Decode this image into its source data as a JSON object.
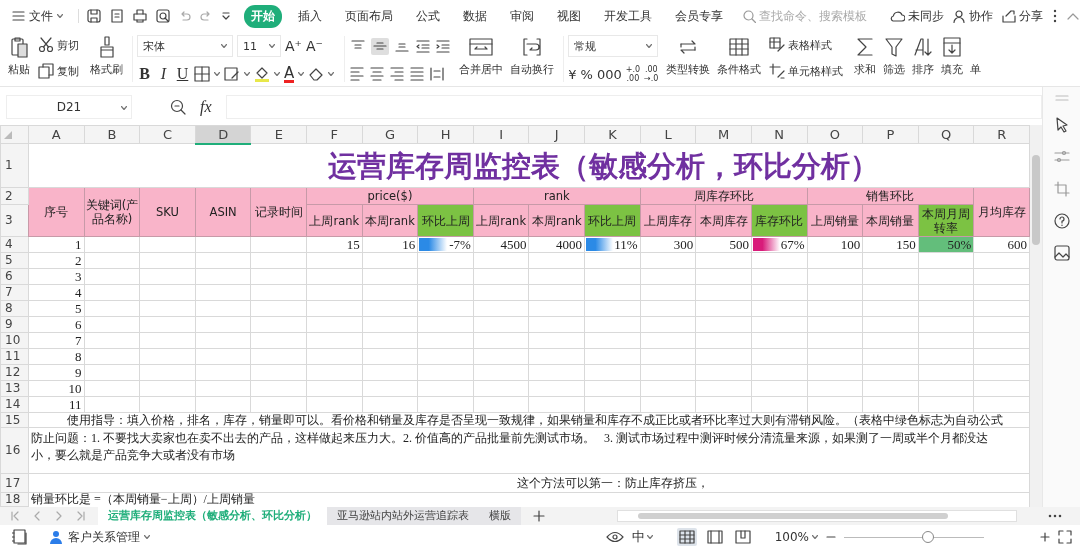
{
  "menu_bar": {
    "file_menu": "文件",
    "tabs": [
      {
        "label": "开始",
        "selected": true
      },
      {
        "label": "插入",
        "selected": false
      },
      {
        "label": "页面布局",
        "selected": false
      },
      {
        "label": "公式",
        "selected": false
      },
      {
        "label": "数据",
        "selected": false
      },
      {
        "label": "审阅",
        "selected": false
      },
      {
        "label": "视图",
        "selected": false
      },
      {
        "label": "开发工具",
        "selected": false
      },
      {
        "label": "会员专享",
        "selected": false
      }
    ],
    "search": {
      "placeholder": "查找命令、搜索模板"
    },
    "actions": [
      {
        "label": "未同步"
      },
      {
        "label": "协作"
      },
      {
        "label": "分享"
      }
    ]
  },
  "ribbon": {
    "clipboard": [
      {
        "label": "粘贴",
        "kind": "large"
      },
      {
        "label": "剪切",
        "kind": "small"
      },
      {
        "label": "复制",
        "kind": "small"
      },
      {
        "label": "格式刷",
        "kind": "large"
      }
    ],
    "font": {
      "name": "宋体",
      "size": "11",
      "grow": "A⁺",
      "shrink": "A⁻",
      "styles": [
        "B",
        "I",
        "U"
      ],
      "color_button": "A"
    },
    "align_toggles": [
      {
        "selected": false
      },
      {
        "selected": true
      },
      {
        "selected": false
      }
    ],
    "align_buttons": [
      {
        "label": "合并居中"
      },
      {
        "label": "自动换行"
      }
    ],
    "number_format": "常规",
    "number_symbols": [
      "¥",
      "%",
      "000"
    ],
    "decimal_buttons": [
      {
        "top": "+.0",
        "bottom": ".00"
      },
      {
        "top": ".00",
        "bottom": "→.0"
      }
    ],
    "tools": [
      {
        "label": "类型转换",
        "kind": "large"
      },
      {
        "label": "条件格式",
        "kind": "large"
      },
      {
        "label": "表格样式",
        "kind": "small"
      },
      {
        "label": "单元格样式",
        "kind": "small"
      },
      {
        "label": "求和",
        "kind": "large"
      },
      {
        "label": "筛选",
        "kind": "large"
      },
      {
        "label": "排序",
        "kind": "large"
      },
      {
        "label": "填充",
        "kind": "large"
      },
      {
        "label": "单",
        "kind": "large"
      }
    ]
  },
  "formula_bar": {
    "name_box": "D21",
    "function_label": "fx"
  },
  "sheet": {
    "columns": [
      {
        "letter": "A",
        "selected": false
      },
      {
        "letter": "B",
        "selected": false
      },
      {
        "letter": "C",
        "selected": false
      },
      {
        "letter": "D",
        "selected": true
      },
      {
        "letter": "E",
        "selected": false
      },
      {
        "letter": "F",
        "selected": false
      },
      {
        "letter": "G",
        "selected": false
      },
      {
        "letter": "H",
        "selected": false
      },
      {
        "letter": "I",
        "selected": false
      },
      {
        "letter": "J",
        "selected": false
      },
      {
        "letter": "K",
        "selected": false
      },
      {
        "letter": "L",
        "selected": false
      },
      {
        "letter": "M",
        "selected": false
      },
      {
        "letter": "N",
        "selected": false
      },
      {
        "letter": "O",
        "selected": false
      },
      {
        "letter": "P",
        "selected": false
      },
      {
        "letter": "Q",
        "selected": false
      },
      {
        "letter": "R",
        "selected": false
      }
    ],
    "row_numbers": [
      "1",
      "2",
      "3",
      "4",
      "5",
      "6",
      "7",
      "8",
      "9",
      "10",
      "11",
      "12",
      "13",
      "14",
      "15",
      "16",
      "17",
      "18"
    ],
    "title": "运营库存周监控表（敏感分析，环比分析）",
    "fixed_headers": [
      "序号",
      "关键词(产品名称)",
      "SKU",
      "ASIN",
      "记录时间"
    ],
    "groups": [
      "price($)",
      "rank",
      "周库存环比",
      "销售环比"
    ],
    "subheaders": [
      {
        "label": "上周rank",
        "color": "#f9b4c9"
      },
      {
        "label": "本周rank",
        "color": "#f9b4c9"
      },
      {
        "label": "环比上周",
        "color": "#7cc243"
      },
      {
        "label": "上周rank",
        "color": "#f9b4c9"
      },
      {
        "label": "本周rank",
        "color": "#f9b4c9"
      },
      {
        "label": "环比上周",
        "color": "#7cc243"
      },
      {
        "label": "上周库存",
        "color": "#f9b4c9"
      },
      {
        "label": "本周库存",
        "color": "#f9b4c9"
      },
      {
        "label": "库存环比",
        "color": "#7cc243"
      },
      {
        "label": "上周销量",
        "color": "#f9b4c9"
      },
      {
        "label": "本周销量",
        "color": "#f9b4c9"
      },
      {
        "label": "本周月周转率",
        "color": "#7cc243"
      }
    ],
    "last_header": "月均库存",
    "rows": [
      {
        "number": "1",
        "cells": [
          {
            "text": "15",
            "kind": "plain"
          },
          {
            "text": "16",
            "kind": "plain"
          },
          {
            "text": "-7%",
            "kind": "bar",
            "level": 0.5,
            "color": "#2b8ae6"
          },
          {
            "text": "4500",
            "kind": "plain"
          },
          {
            "text": "4000",
            "kind": "plain"
          },
          {
            "text": "11%",
            "kind": "bar",
            "level": 0.5,
            "color": "#2b8ae6"
          },
          {
            "text": "300",
            "kind": "plain"
          },
          {
            "text": "500",
            "kind": "plain"
          },
          {
            "text": "67%",
            "kind": "bar",
            "level": 0.5,
            "color": "#d81b7a"
          },
          {
            "text": "100",
            "kind": "plain"
          },
          {
            "text": "150",
            "kind": "plain"
          },
          {
            "text": "50%",
            "kind": "fill",
            "color": "#63be7b"
          },
          {
            "text": "600",
            "kind": "plain"
          }
        ]
      },
      {
        "number": "2"
      },
      {
        "number": "3"
      },
      {
        "number": "4"
      },
      {
        "number": "5"
      },
      {
        "number": "6"
      },
      {
        "number": "7"
      },
      {
        "number": "8"
      },
      {
        "number": "9"
      },
      {
        "number": "10"
      },
      {
        "number": "11"
      }
    ],
    "guide": "使用指导：填入价格，排名，库存，销量即可以。看价格和销量及库存是否呈现一致规律，如果销量和库存不成正比或者环比率过大则有滞销风险。（表格中绿色标志为自动公式",
    "prevention": [
      "防止问题：1. 不要找大卖家也在卖不出去的产品，这样做起来压力大。2. 价值高的产品批量前先测试市场。   3. 测试市场过程中测评时候分清流量来源，如果测了一周或半个月都没达",
      "小，要么就是产品竞争大或者没有市场"
    ],
    "method": "这个方法可以第一：防止库存挤压，",
    "formula": "销量环比是 =（本周销量−上周）/上周销量"
  },
  "sheet_tabs": [
    {
      "label": "运营库存周监控表（敏感分析、环比分析）",
      "selected": true
    },
    {
      "label": "亚马逊站内站外运营追踪表",
      "selected": false
    },
    {
      "label": "横版",
      "selected": false
    }
  ],
  "status_bar": {
    "app_label": "客户关系管理",
    "input_mode": "中",
    "view_modes": [
      {
        "selected": true
      },
      {
        "selected": false
      },
      {
        "selected": false
      }
    ],
    "zoom": "100%",
    "zoom_slider": {
      "level": 0.6
    }
  }
}
